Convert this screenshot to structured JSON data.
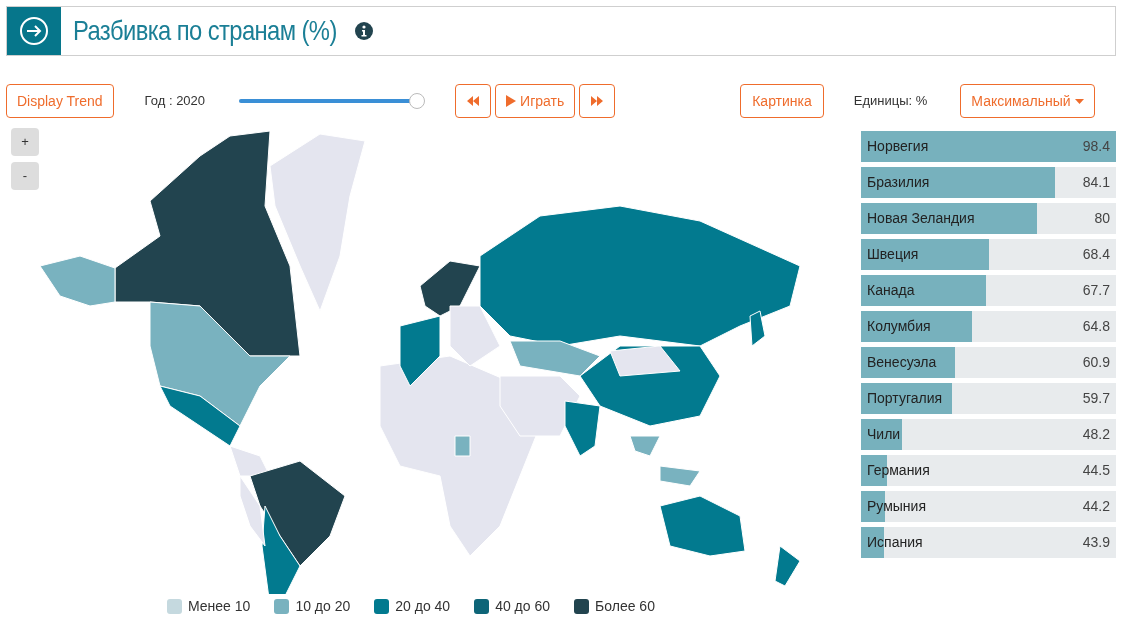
{
  "header": {
    "title": "Разбивка по странам (%)"
  },
  "controls": {
    "trend_button": "Display Trend",
    "year_label": "Год : 2020",
    "year_slider": {
      "level": 1
    },
    "play_button": "Играть",
    "image_button": "Картинка",
    "units_label": "Единицы: %",
    "sort_dropdown": "Максимальный"
  },
  "zoom": {
    "in": "+",
    "out": "-"
  },
  "legend": [
    {
      "label": "Менее 10",
      "color": "#c5d9df"
    },
    {
      "label": "10 до 20",
      "color": "#79b2bf"
    },
    {
      "label": "20 до 40",
      "color": "#027a8f"
    },
    {
      "label": "40 до 60",
      "color": "#0e6578"
    },
    {
      "label": "Более 60",
      "color": "#22444f"
    }
  ],
  "ranking": [
    {
      "name": "Норвегия",
      "value": "98.4",
      "level": 1
    },
    {
      "name": "Бразилия",
      "value": "84.1",
      "level": 0.76
    },
    {
      "name": "Новая Зеландия",
      "value": "80",
      "level": 0.69
    },
    {
      "name": "Швеция",
      "value": "68.4",
      "level": 0.5
    },
    {
      "name": "Канада",
      "value": "67.7",
      "level": 0.49
    },
    {
      "name": "Колумбия",
      "value": "64.8",
      "level": 0.435
    },
    {
      "name": "Венесуэла",
      "value": "60.9",
      "level": 0.37
    },
    {
      "name": "Португалия",
      "value": "59.7",
      "level": 0.355
    },
    {
      "name": "Чили",
      "value": "48.2",
      "level": 0.16
    },
    {
      "name": "Германия",
      "value": "44.5",
      "level": 0.1
    },
    {
      "name": "Румыния",
      "value": "44.2",
      "level": 0.095
    },
    {
      "name": "Испания",
      "value": "43.9",
      "level": 0.09
    }
  ]
}
